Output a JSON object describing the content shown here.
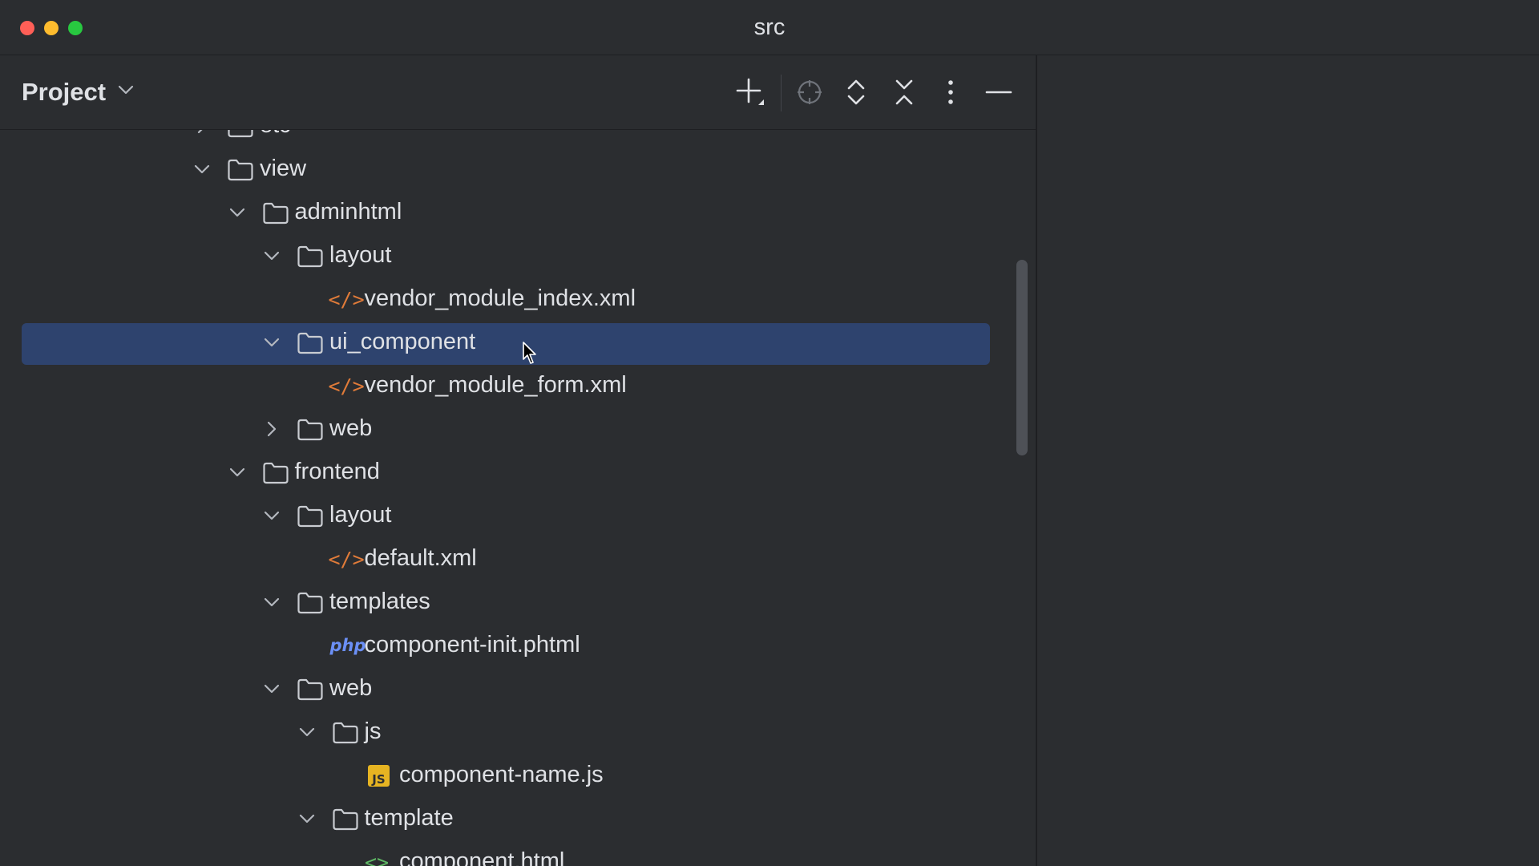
{
  "window": {
    "title": "src"
  },
  "panel": {
    "title": "Project",
    "toolbar": [
      "add-icon",
      "locate-icon",
      "expand-all-icon",
      "collapse-all-icon",
      "more-icon",
      "minimize-icon"
    ]
  },
  "tree": [
    {
      "label": "etc",
      "type": "folder",
      "expanded": false
    },
    {
      "label": "view",
      "type": "folder",
      "expanded": true
    },
    {
      "label": "adminhtml",
      "type": "folder",
      "expanded": true
    },
    {
      "label": "layout",
      "type": "folder",
      "expanded": true
    },
    {
      "label": "vendor_module_index.xml",
      "type": "xml"
    },
    {
      "label": "ui_component",
      "type": "folder",
      "expanded": true,
      "selected": true
    },
    {
      "label": "vendor_module_form.xml",
      "type": "xml"
    },
    {
      "label": "web",
      "type": "folder",
      "expanded": false
    },
    {
      "label": "frontend",
      "type": "folder",
      "expanded": true
    },
    {
      "label": "layout",
      "type": "folder",
      "expanded": true
    },
    {
      "label": "default.xml",
      "type": "xml"
    },
    {
      "label": "templates",
      "type": "folder",
      "expanded": true
    },
    {
      "label": "component-init.phtml",
      "type": "php"
    },
    {
      "label": "web",
      "type": "folder",
      "expanded": true
    },
    {
      "label": "js",
      "type": "folder",
      "expanded": true
    },
    {
      "label": "component-name.js",
      "type": "js"
    },
    {
      "label": "template",
      "type": "folder",
      "expanded": true
    },
    {
      "label": "component.html",
      "type": "html"
    }
  ],
  "icons": {
    "php_text": "php",
    "js_text": "JS",
    "xml_glyph": "</>",
    "html_glyph": "<>"
  },
  "colors": {
    "selection": "#2e436e",
    "xml": "#e07b39",
    "php": "#6b8ff5",
    "js": "#e6b422",
    "html": "#5fb865"
  }
}
